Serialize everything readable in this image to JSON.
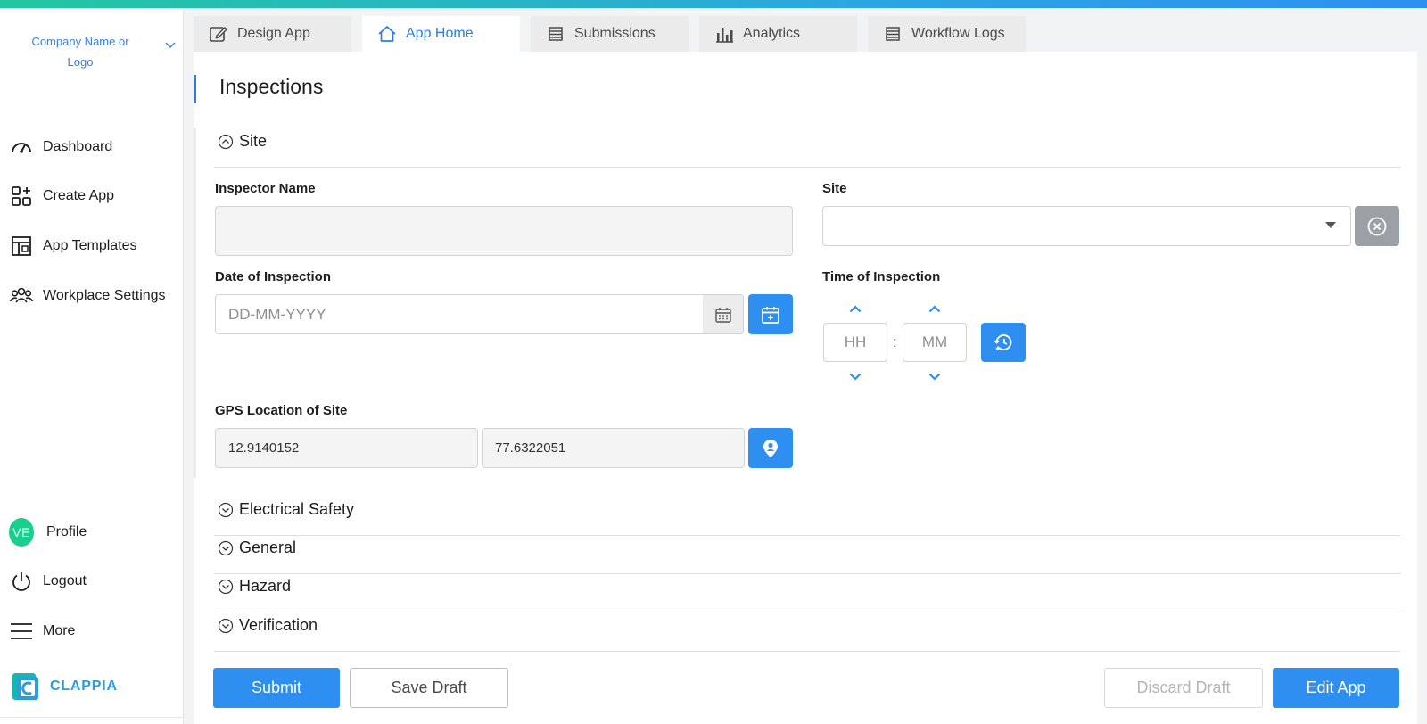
{
  "sidebar": {
    "company": "Company Name or Logo",
    "nav": [
      {
        "label": "Dashboard",
        "icon": "dashboard-gauge-icon"
      },
      {
        "label": "Create App",
        "icon": "create-app-grid-icon"
      },
      {
        "label": "App Templates",
        "icon": "template-layout-icon"
      },
      {
        "label": "Workplace Settings",
        "icon": "users-group-icon"
      }
    ],
    "profile": {
      "initials": "VE",
      "label": "Profile"
    },
    "logout": "Logout",
    "more": "More",
    "brand": "CLAPPIA"
  },
  "tabs": [
    {
      "label": "Design App",
      "icon": "edit-icon",
      "active": false
    },
    {
      "label": "App Home",
      "icon": "home-icon",
      "active": true
    },
    {
      "label": "Submissions",
      "icon": "list-icon",
      "active": false
    },
    {
      "label": "Analytics",
      "icon": "bar-chart-icon",
      "active": false
    },
    {
      "label": "Workflow Logs",
      "icon": "list-icon",
      "active": false
    }
  ],
  "page": {
    "title": "Inspections"
  },
  "sections": {
    "site": "Site",
    "collapsed": [
      "Electrical Safety",
      "General",
      "Hazard",
      "Verification"
    ]
  },
  "form": {
    "inspector_name": {
      "label": "Inspector Name",
      "value": ""
    },
    "site": {
      "label": "Site",
      "value": ""
    },
    "date": {
      "label": "Date of Inspection",
      "placeholder": "DD-MM-YYYY"
    },
    "time": {
      "label": "Time of Inspection",
      "hh": "HH",
      "mm": "MM",
      "sep": ":"
    },
    "gps": {
      "label": "GPS Location of Site",
      "lat": "12.9140152",
      "lng": "77.6322051"
    }
  },
  "actions": {
    "submit": "Submit",
    "save_draft": "Save Draft",
    "discard_draft": "Discard Draft",
    "edit_app": "Edit App"
  },
  "colors": {
    "accent": "#2f8ff0",
    "avatar": "#18cf8e",
    "brand": "#2a9de0"
  }
}
